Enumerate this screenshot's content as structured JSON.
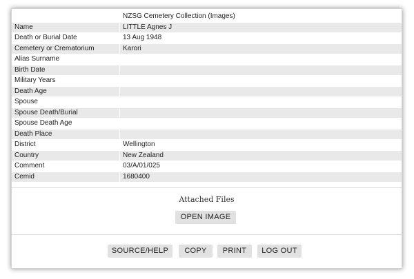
{
  "header": {
    "collection": "NZSG Cemetery Collection (Images)"
  },
  "fields": [
    {
      "label": "Name",
      "value": "LITTLE Agnes J"
    },
    {
      "label": "Death or Burial Date",
      "value": "13 Aug 1948"
    },
    {
      "label": "Cemetery or Crematorium",
      "value": "Karori"
    },
    {
      "label": "Alias Surname",
      "value": ""
    },
    {
      "label": "Birth Date",
      "value": ""
    },
    {
      "label": "Military Years",
      "value": ""
    },
    {
      "label": "Death Age",
      "value": ""
    },
    {
      "label": "Spouse",
      "value": ""
    },
    {
      "label": "Spouse Death/Burial",
      "value": ""
    },
    {
      "label": "Spouse Death Age",
      "value": ""
    },
    {
      "label": "Death Place",
      "value": ""
    },
    {
      "label": "District",
      "value": "Wellington"
    },
    {
      "label": "Country",
      "value": "New Zealand"
    },
    {
      "label": "Comment",
      "value": "03/A/01/025"
    },
    {
      "label": "Cemid",
      "value": "1680400"
    }
  ],
  "attachments": {
    "heading": "Attached Files",
    "open_image_label": "OPEN IMAGE"
  },
  "footer": {
    "source_help_label": "SOURCE/HELP",
    "copy_label": "COPY",
    "print_label": "PRINT",
    "logout_label": "LOG OUT"
  },
  "colors": {
    "row_shade": "#e9e9e9",
    "button_bg": "#e1e1e1",
    "panel_border": "#d4d4d4"
  }
}
